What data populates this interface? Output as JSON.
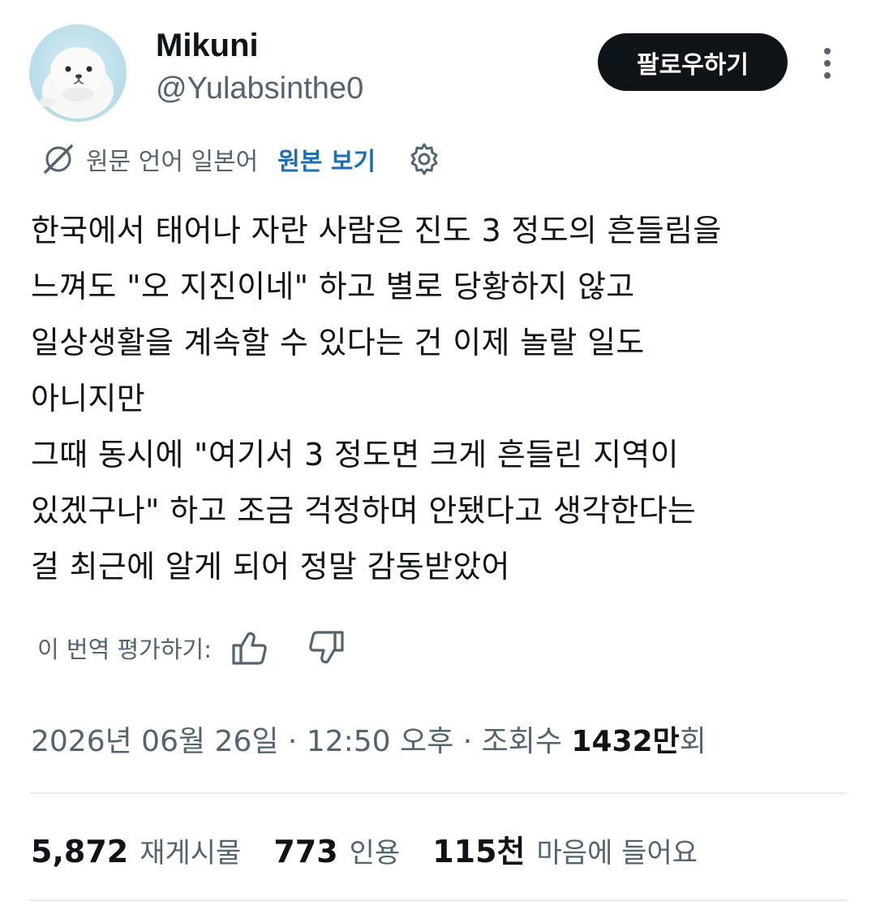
{
  "author": {
    "display_name": "Mikuni",
    "handle": "@Yulabsinthe0",
    "avatar_icon": "seal-avatar"
  },
  "actions": {
    "follow_label": "팔로우하기",
    "more_icon": "more-vertical-icon"
  },
  "translation": {
    "note": "원문 언어 일본어",
    "show_original_label": "원본 보기",
    "icon": "translate-icon",
    "settings_icon": "gear-icon"
  },
  "tweet": {
    "text": "한국에서 태어나 자란 사람은 진도 3 정도의 흔들림을\n느껴도 \"오 지진이네\" 하고 별로 당황하지 않고\n일상생활을 계속할 수 있다는 건 이제 놀랄 일도\n아니지만\n그때 동시에 \"여기서 3 정도면 크게 흔들린 지역이\n있겠구나\" 하고 조금 걱정하며 안됐다고 생각한다는\n걸 최근에 알게 되어 정말 감동받았어"
  },
  "rating": {
    "label": "이 번역 평가하기:",
    "like_icon": "thumbs-up-icon",
    "dislike_icon": "thumbs-down-icon"
  },
  "meta": {
    "date": "2026년 06월 26일",
    "sep1": " · ",
    "time": "12:50 오후",
    "sep2": " · ",
    "views_label": "조회수 ",
    "views_value": "1432만",
    "views_suffix": "회"
  },
  "stats": {
    "reposts_value": "5,872",
    "reposts_label": "재게시물",
    "quotes_value": "773",
    "quotes_label": "인용",
    "likes_value": "115천",
    "likes_label": "마음에 들어요"
  },
  "colors": {
    "text_primary": "#0f1419",
    "text_secondary": "#536471",
    "link": "#1d6fb0",
    "button_bg": "#0f1419",
    "divider": "#e7ebee"
  }
}
